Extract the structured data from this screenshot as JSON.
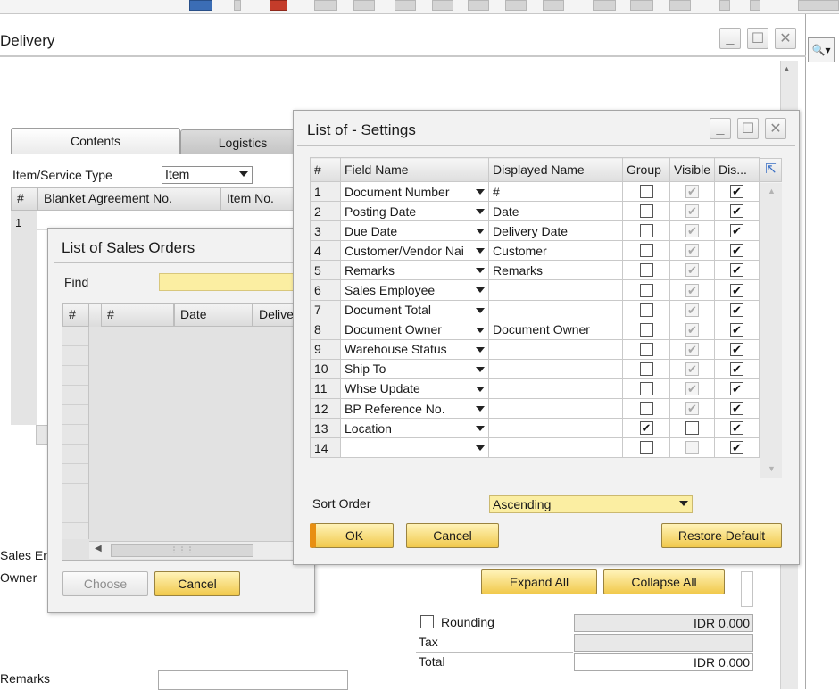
{
  "delivery_window": {
    "title": "Delivery",
    "tabs": [
      {
        "label": "Contents"
      },
      {
        "label": "Logistics"
      }
    ],
    "item_type_label": "Item/Service Type",
    "item_type_value": "Item",
    "columns": [
      "#",
      "Blanket Agreement No.",
      "Item No."
    ],
    "row_number": "1",
    "sales_employee_label": "Sales Er",
    "owner_label": "Owner",
    "remarks_label": "Remarks",
    "rounding_label": "Rounding",
    "rounding_value": "IDR 0.000",
    "tax_label": "Tax",
    "total_label": "Total",
    "total_value": "IDR 0.000",
    "expand_all": "Expand All",
    "collapse_all": "Collapse All"
  },
  "sales_orders_dialog": {
    "title": "List of Sales Orders",
    "find_label": "Find",
    "columns": [
      "#",
      "#",
      "Date",
      "Delive"
    ],
    "choose": "Choose",
    "cancel": "Cancel"
  },
  "settings_dialog": {
    "title": "List of - Settings",
    "columns": [
      "#",
      "Field Name",
      "Displayed Name",
      "Group",
      "Visible",
      "Dis..."
    ],
    "rows": [
      {
        "num": "1",
        "field": "Document Number",
        "display": "#",
        "group": false,
        "visible": true,
        "dis": true
      },
      {
        "num": "2",
        "field": "Posting Date",
        "display": "Date",
        "group": false,
        "visible": true,
        "dis": true
      },
      {
        "num": "3",
        "field": "Due Date",
        "display": "Delivery Date",
        "group": false,
        "visible": true,
        "dis": true
      },
      {
        "num": "4",
        "field": "Customer/Vendor Nai",
        "display": "Customer",
        "group": false,
        "visible": true,
        "dis": true
      },
      {
        "num": "5",
        "field": "Remarks",
        "display": "Remarks",
        "group": false,
        "visible": true,
        "dis": true
      },
      {
        "num": "6",
        "field": "Sales Employee",
        "display": "",
        "group": false,
        "visible": true,
        "dis": true
      },
      {
        "num": "7",
        "field": "Document Total",
        "display": "",
        "group": false,
        "visible": true,
        "dis": true
      },
      {
        "num": "8",
        "field": "Document Owner",
        "display": "Document Owner",
        "group": false,
        "visible": true,
        "dis": true
      },
      {
        "num": "9",
        "field": "Warehouse Status",
        "display": "",
        "group": false,
        "visible": true,
        "dis": true
      },
      {
        "num": "10",
        "field": "Ship To",
        "display": "",
        "group": false,
        "visible": true,
        "dis": true
      },
      {
        "num": "11",
        "field": "Whse Update",
        "display": "",
        "group": false,
        "visible": true,
        "dis": true
      },
      {
        "num": "12",
        "field": "BP Reference No.",
        "display": "",
        "group": false,
        "visible": true,
        "dis": true
      },
      {
        "num": "13",
        "field": "Location",
        "display": "",
        "group": true,
        "visible": false,
        "dis": true
      },
      {
        "num": "14",
        "field": "",
        "display": "",
        "group": false,
        "visible": false,
        "dis": true
      }
    ],
    "sort_order_label": "Sort Order",
    "sort_order_value": "Ascending",
    "ok": "OK",
    "cancel": "Cancel",
    "restore_default": "Restore Default"
  },
  "icons": {
    "checkmark": "✔",
    "expand": "⇱"
  }
}
